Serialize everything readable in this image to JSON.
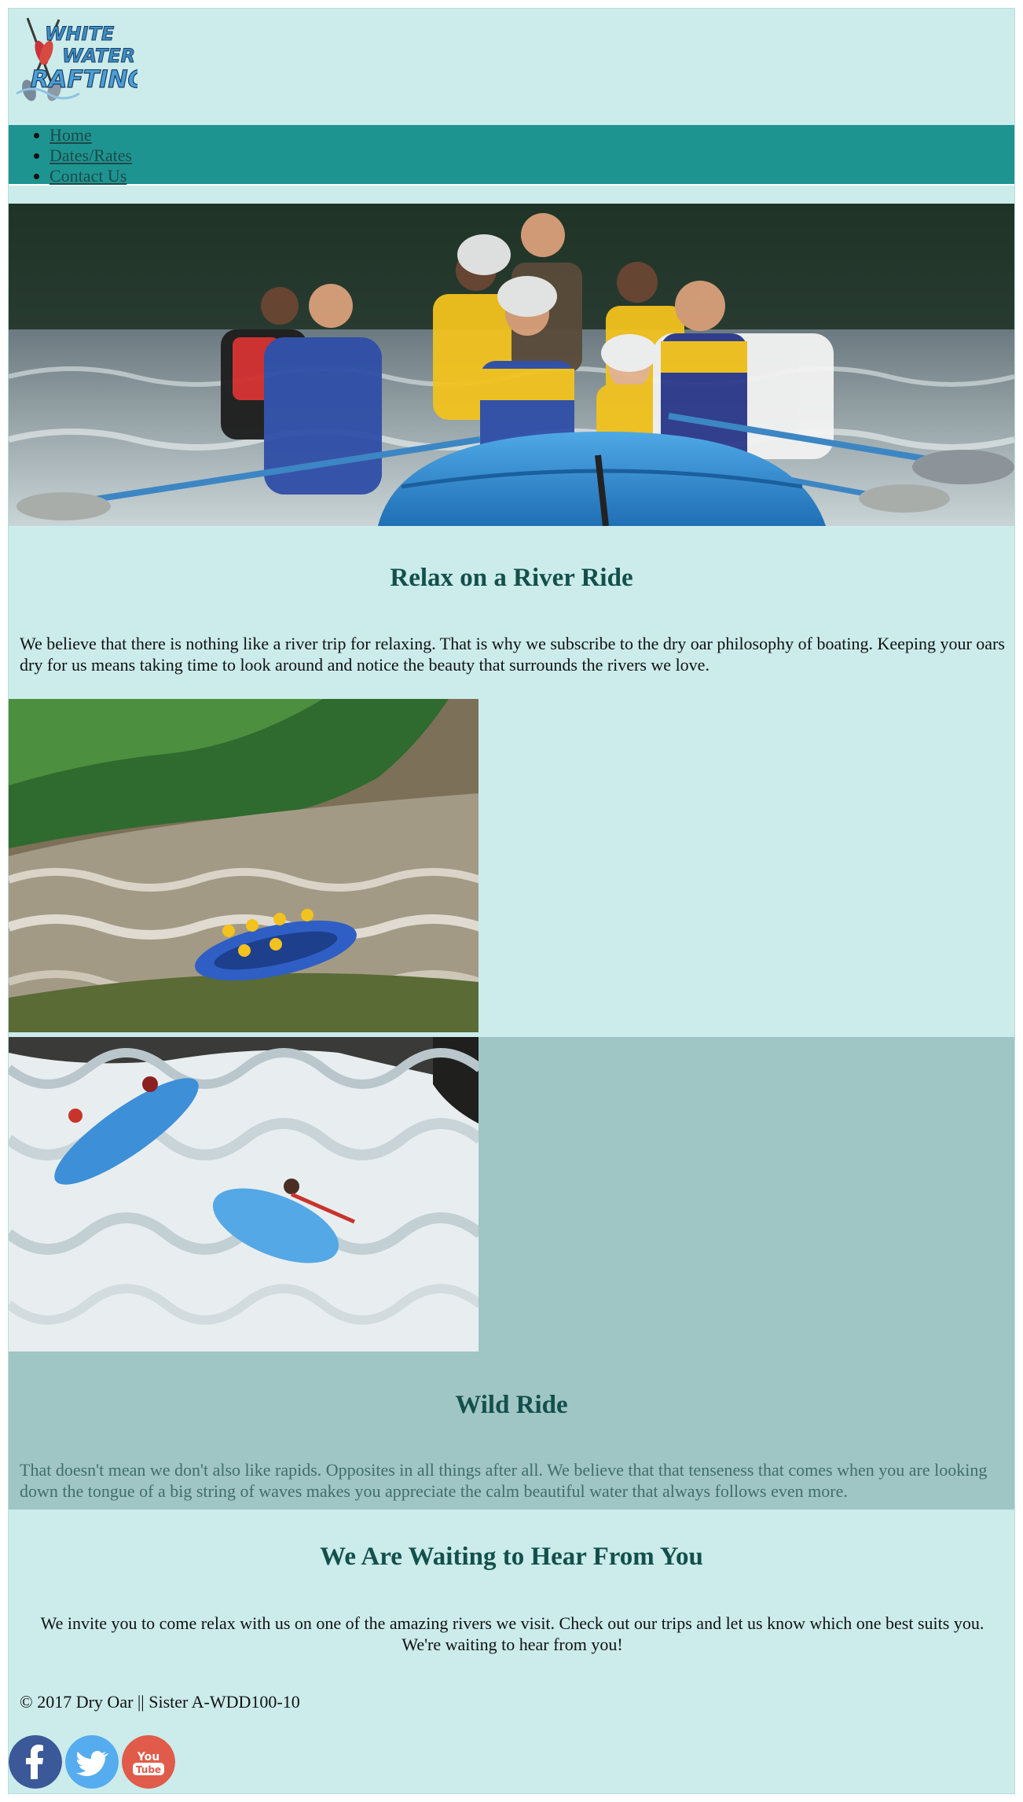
{
  "brand": {
    "logo_lines": [
      "WHITE",
      "WATER",
      "RAFTING"
    ]
  },
  "nav": {
    "items": [
      {
        "label": "Home"
      },
      {
        "label": "Dates/Rates"
      },
      {
        "label": "Contact Us"
      }
    ]
  },
  "section1": {
    "title": "Relax on a River Ride",
    "body": "We believe that there is nothing like a river trip for relaxing. That is why we subscribe to the dry oar philosophy of boating. Keeping your oars dry for us means taking time to look around and notice the beauty that surrounds the rivers we love."
  },
  "section2": {
    "title": "Wild Ride",
    "body": "That doesn't mean we don't also like rapids. Opposites in all things after all. We believe that that tenseness that comes when you are looking down the tongue of a big string of waves makes you appreciate the calm beautiful water that always follows even more."
  },
  "section3": {
    "title": "We Are Waiting to Hear From You",
    "body": "We invite you to come relax with us on one of the amazing rivers we visit. Check out our trips and let us know which one best suits you. We're waiting to hear from you!"
  },
  "footer": {
    "copyright": "© 2017 Dry Oar || Sister A-WDD100-10"
  },
  "social": {
    "youtube_label": "You Tube"
  },
  "colors": {
    "page_bg": "#cbeceb",
    "nav_bg": "#1e9491",
    "heading": "#13504c",
    "wild_band": "#a0c5c5",
    "facebook": "#3b5998",
    "twitter": "#55acee",
    "youtube": "#e05b4a"
  }
}
